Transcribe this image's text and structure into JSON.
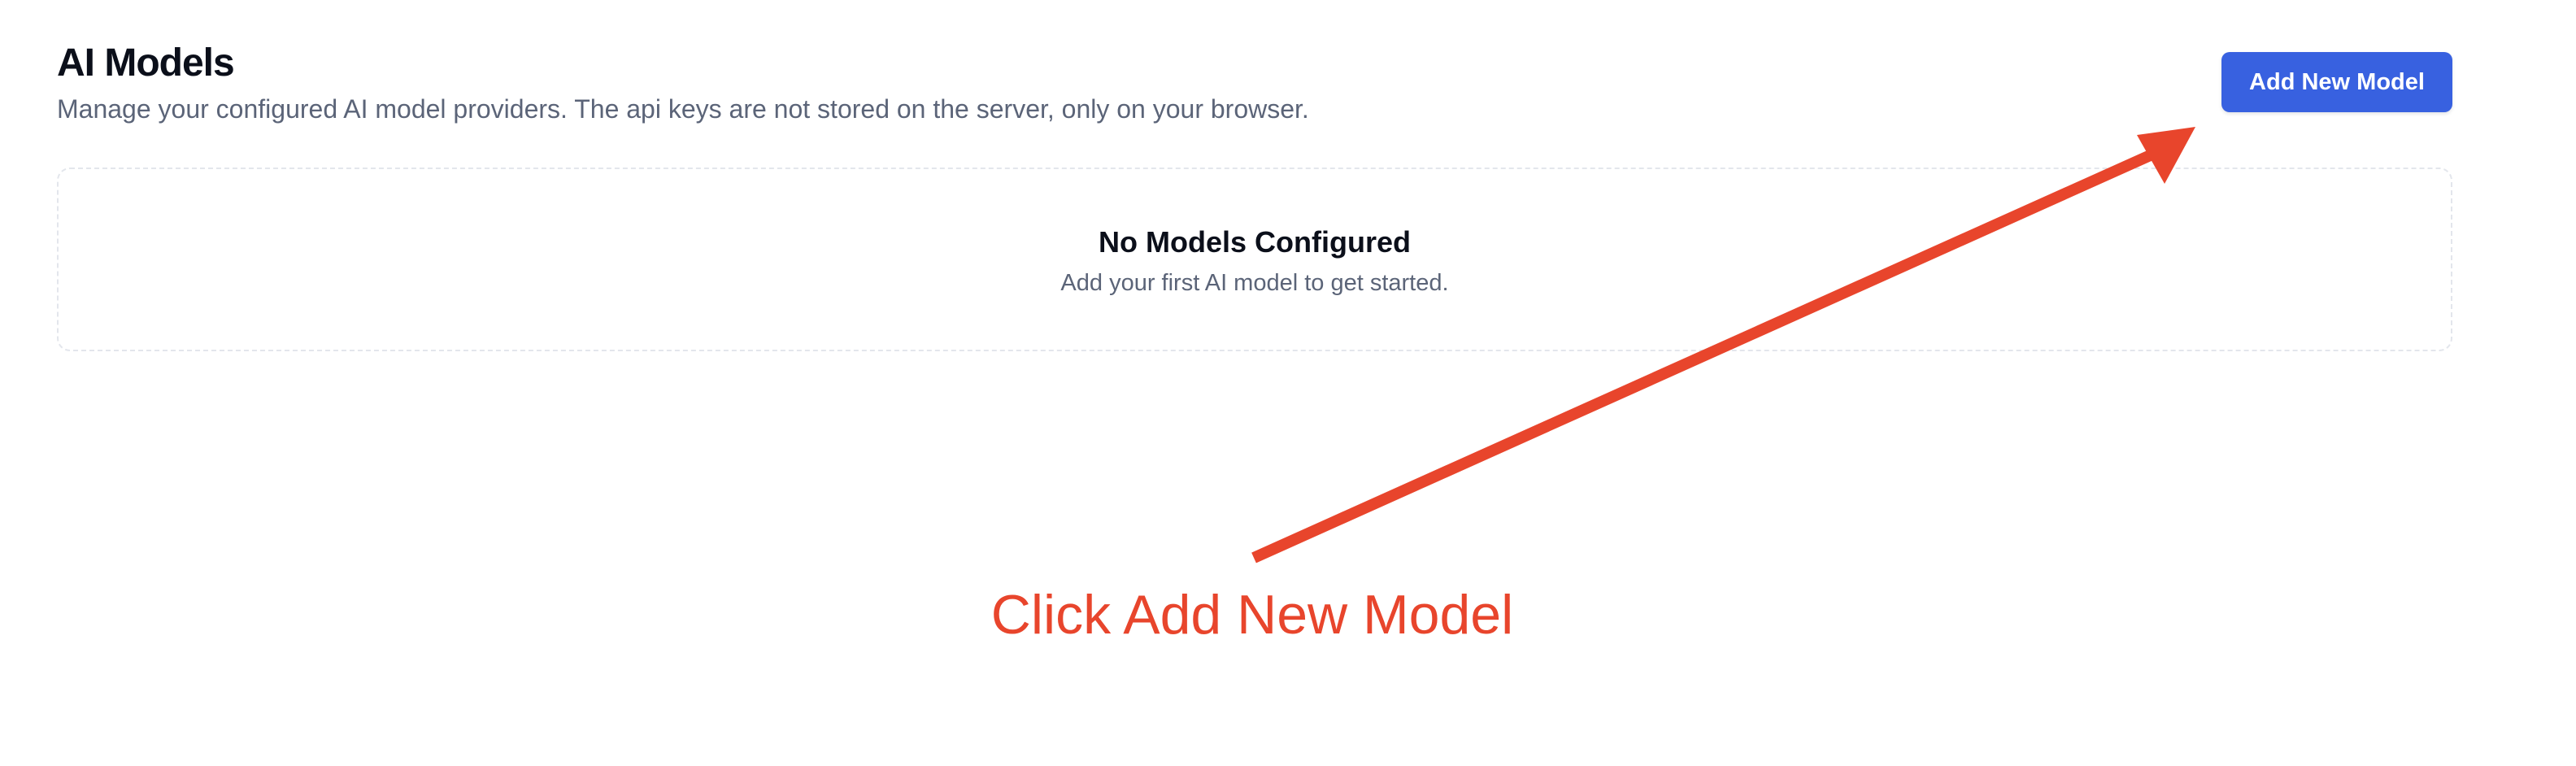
{
  "header": {
    "title": "AI Models",
    "subtitle": "Manage your configured AI model providers. The api keys are not stored on the server, only on your browser.",
    "add_button_label": "Add New Model"
  },
  "empty_state": {
    "title": "No Models Configured",
    "message": "Add your first AI model to get started."
  },
  "annotation": {
    "text": "Click Add New Model",
    "icon": "arrow-icon",
    "color": "#e8452c"
  },
  "colors": {
    "accent": "#3861e0",
    "title": "#0b0f1a",
    "muted": "#5b6478",
    "annotation": "#e8452c"
  }
}
